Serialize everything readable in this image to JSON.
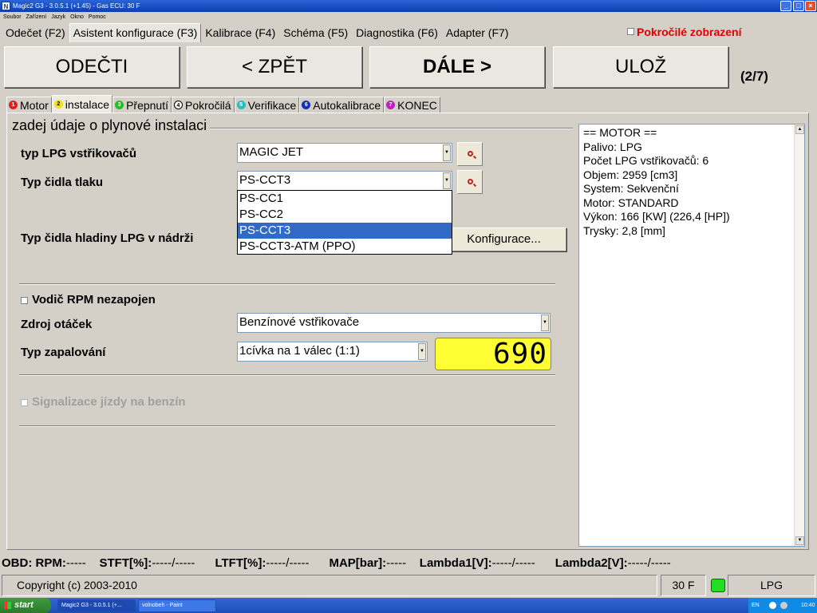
{
  "window": {
    "title": "Magic2 G3 - 3.0.5.1 (+1.45) - Gas ECU: 30 F",
    "icon_letter": "N",
    "minimize_glyph": "_",
    "maximize_glyph": "□",
    "close_glyph": "×"
  },
  "menu": [
    "Soubor",
    "Zařízení",
    "Jazyk",
    "Okno",
    "Pomoc"
  ],
  "top_tabs": [
    {
      "label": "Odečet (F2)"
    },
    {
      "label": "Asistent konfigurace (F3)",
      "active": true
    },
    {
      "label": "Kalibrace (F4)"
    },
    {
      "label": "Schéma (F5)"
    },
    {
      "label": "Diagnostika (F6)"
    },
    {
      "label": "Adapter (F7)"
    }
  ],
  "advanced_view": {
    "label": "Pokročilé zobrazení",
    "checked": false
  },
  "nav": {
    "read_label": "ODEČTI",
    "back_label": "< ZPĚT",
    "next_label": "DÁLE >",
    "save_label": "ULOŽ",
    "step": "(2/7)"
  },
  "sub_tabs": [
    {
      "num": "1",
      "label": "Motor",
      "color": "#e02020"
    },
    {
      "num": "2",
      "label": "instalace",
      "color": "#f0e020",
      "active": true
    },
    {
      "num": "3",
      "label": "Přepnutí",
      "color": "#20c020"
    },
    {
      "num": "4",
      "label": "Pokročilá",
      "color": "#ffffff"
    },
    {
      "num": "5",
      "label": "Verifikace",
      "color": "#20c0c0"
    },
    {
      "num": "6",
      "label": "Autokalibrace",
      "color": "#1030c0"
    },
    {
      "num": "7",
      "label": "KONEC",
      "color": "#c020c0"
    }
  ],
  "form": {
    "group_title": "zadej údaje o plynové instalaci",
    "injector_label": "typ LPG vstřikovačů",
    "injector_value": "MAGIC JET",
    "pressure_label": "Typ čidla tlaku",
    "pressure_value": "PS-CCT3",
    "pressure_options": [
      "PS-CC1",
      "PS-CC2",
      "PS-CCT3",
      "PS-CCT3-ATM (PPO)"
    ],
    "pressure_selected_index": 2,
    "level_label": "Typ čidla hladiny LPG v nádrži",
    "config_button": "Konfigurace...",
    "rpm_wire_label": "Vodič RPM nezapojen",
    "rpm_wire_checked": false,
    "rpm_source_label": "Zdroj otáček",
    "rpm_source_value": "Benzínové vstřikovače",
    "ignition_label": "Typ zapalování",
    "ignition_value": "1cívka na 1 válec (1:1)",
    "rpm_display": "690",
    "petrol_signal_label": "Signalizace jízdy na benzín",
    "petrol_signal_checked": false
  },
  "info_lines": [
    "== MOTOR ==",
    "Palivo: LPG",
    "Počet LPG vstřikovačů: 6",
    "Objem: 2959 [cm3]",
    "System: Sekvenční",
    "Motor: STANDARD",
    "Výkon: 166 [KW] (226,4 [HP])",
    "Trysky: 2,8 [mm]"
  ],
  "obd": {
    "prefix": "OBD:",
    "rpm_label": "RPM:",
    "rpm_value": "-----",
    "stft_label": "STFT[%]:",
    "stft_value": "-----/-----",
    "ltft_label": "LTFT[%]:",
    "ltft_value": "-----/-----",
    "map_label": "MAP[bar]:",
    "map_value": "-----",
    "lambda1_label": "Lambda1[V]:",
    "lambda1_value": "-----/-----",
    "lambda2_label": "Lambda2[V]:",
    "lambda2_value": "-----/-----"
  },
  "status": {
    "copyright": "Copyright (c) 2003-2010",
    "ecu": "30 F",
    "fuel": "LPG",
    "lamp_color": "#22dd22"
  },
  "taskbar": {
    "start_label": "start",
    "tasks": [
      "Magic2 G3 - 3.0.5.1 (+...",
      "volnobeh - Paint"
    ],
    "lang": "EN",
    "clock": "10:40"
  }
}
